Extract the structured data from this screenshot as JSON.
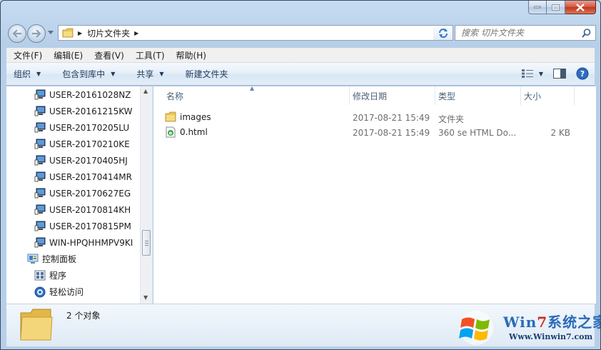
{
  "address": {
    "crumb": "切片文件夹"
  },
  "search": {
    "placeholder": "搜索 切片文件夹"
  },
  "menu": [
    "文件(F)",
    "编辑(E)",
    "查看(V)",
    "工具(T)",
    "帮助(H)"
  ],
  "commands": {
    "organize": "组织",
    "include": "包含到库中",
    "share": "共享",
    "new_folder": "新建文件夹"
  },
  "nav": {
    "computers": [
      "USER-20161028NZ",
      "USER-20161215KW",
      "USER-20170205LU",
      "USER-20170210KE",
      "USER-20170405HJ",
      "USER-20170414MR",
      "USER-20170627EG",
      "USER-20170814KH",
      "USER-20170815PM",
      "WIN-HPQHHMPV9KI"
    ],
    "control_panel": "控制面板",
    "programs": "程序",
    "ease": "轻松访问"
  },
  "columns": {
    "name": "名称",
    "modified": "修改日期",
    "type": "类型",
    "size": "大小"
  },
  "files": [
    {
      "name": "images",
      "modified": "2017-08-21 15:49",
      "type": "文件夹",
      "size": "",
      "icon": "folder-icon"
    },
    {
      "name": "0.html",
      "modified": "2017-08-21 15:49",
      "type": "360 se HTML Do...",
      "size": "2 KB",
      "icon": "html-file-icon"
    }
  ],
  "details": {
    "count": "2 个对象"
  },
  "watermark": {
    "brand_pre": "Win",
    "brand_num": "7",
    "brand_post": "系统之家",
    "url": "Www.Winwin7.com"
  },
  "colors": {
    "accent": "#2a6bb8",
    "brand_red": "#d42b1e"
  }
}
